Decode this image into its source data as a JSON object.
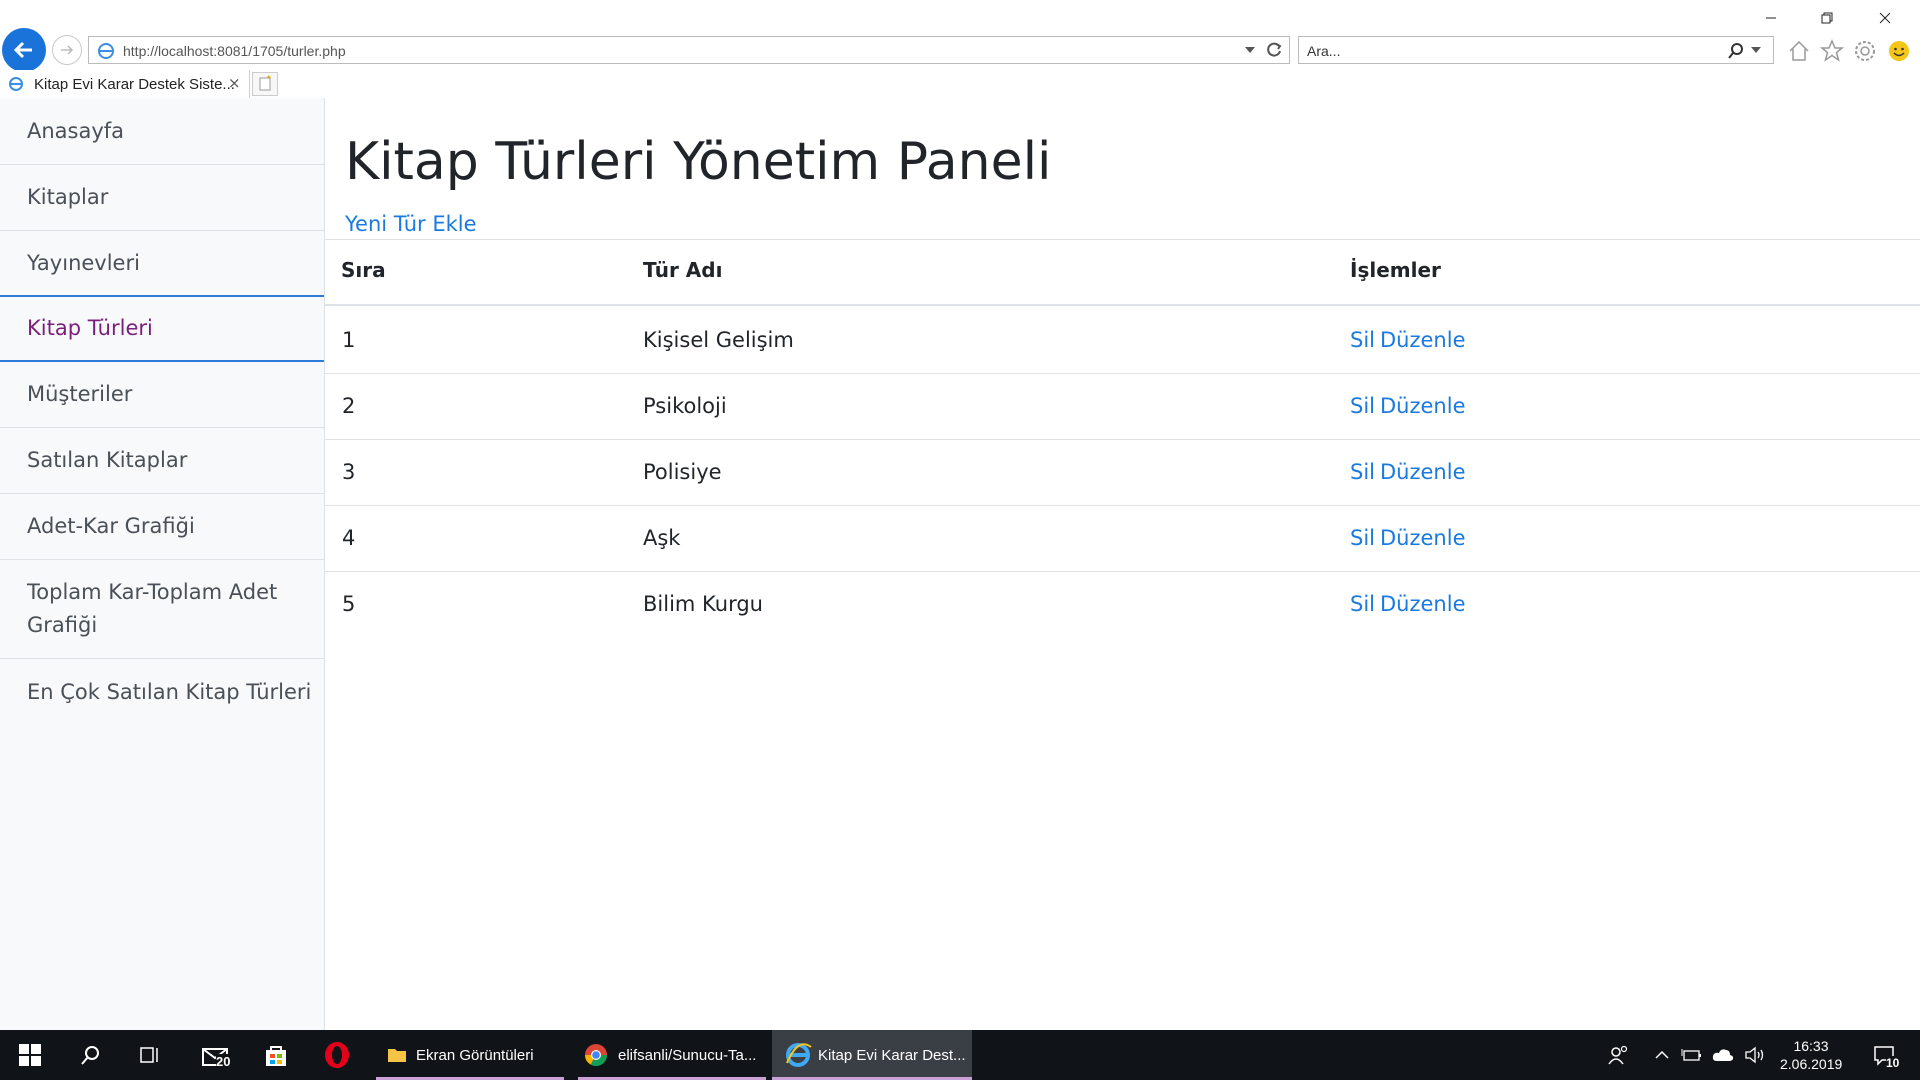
{
  "browser": {
    "url": "http://localhost:8081/1705/turler.php",
    "search_placeholder": "Ara...",
    "tab_title": "Kitap Evi Karar Destek Siste...",
    "tab_close": "×"
  },
  "sidebar": {
    "items": [
      {
        "label": "Anasayfa"
      },
      {
        "label": "Kitaplar"
      },
      {
        "label": "Yayınevleri"
      },
      {
        "label": "Kitap Türleri"
      },
      {
        "label": "Müşteriler"
      },
      {
        "label": "Satılan Kitaplar"
      },
      {
        "label": "Adet-Kar Grafiği"
      },
      {
        "label": "Toplam Kar-Toplam Adet Grafiği"
      },
      {
        "label": "En Çok Satılan Kitap Türleri"
      }
    ]
  },
  "main": {
    "title": "Kitap Türleri Yönetim Paneli",
    "add_link": "Yeni Tür Ekle",
    "table": {
      "headers": [
        "Sıra",
        "Tür Adı",
        "İşlemler"
      ],
      "rows": [
        {
          "no": "1",
          "name": "Kişisel Gelişim",
          "delete": "Sil",
          "edit": "Düzenle"
        },
        {
          "no": "2",
          "name": "Psikoloji",
          "delete": "Sil",
          "edit": "Düzenle"
        },
        {
          "no": "3",
          "name": "Polisiye",
          "delete": "Sil",
          "edit": "Düzenle"
        },
        {
          "no": "4",
          "name": "Aşk",
          "delete": "Sil",
          "edit": "Düzenle"
        },
        {
          "no": "5",
          "name": "Bilim Kurgu",
          "delete": "Sil",
          "edit": "Düzenle"
        }
      ]
    }
  },
  "taskbar": {
    "mail_badge": "20",
    "apps": [
      {
        "label": "Ekran Görüntüleri"
      },
      {
        "label": "elifsanli/Sunucu-Ta..."
      },
      {
        "label": "Kitap Evi Karar Dest..."
      }
    ],
    "time": "16:33",
    "date": "2.06.2019",
    "notif_badge": "10"
  },
  "colors": {
    "link": "#1a7ae0",
    "active_nav": "#7a1f7d",
    "taskbar": "#101418"
  }
}
